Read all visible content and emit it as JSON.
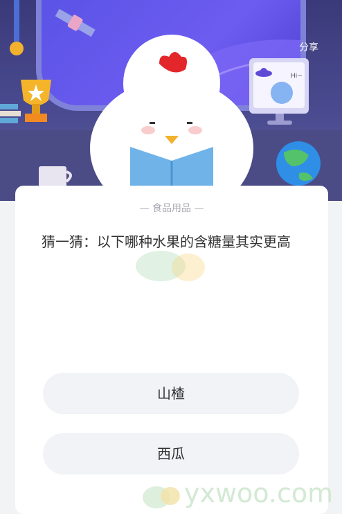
{
  "header": {
    "share_label": "分享"
  },
  "card": {
    "category": "— 食品用品 —",
    "question": "猜一猜：以下哪种水果的含糖量其实更高",
    "answers": [
      {
        "label": "山楂"
      },
      {
        "label": "西瓜"
      }
    ]
  },
  "illustration": {
    "monitor_text": "Hi~"
  },
  "watermark": {
    "text": "yxwoo.com"
  },
  "colors": {
    "scene_bg": "#3a3a7a",
    "window": "#5a53e6",
    "answer_bg": "#f1f3f7",
    "card_bg": "#ffffff"
  }
}
